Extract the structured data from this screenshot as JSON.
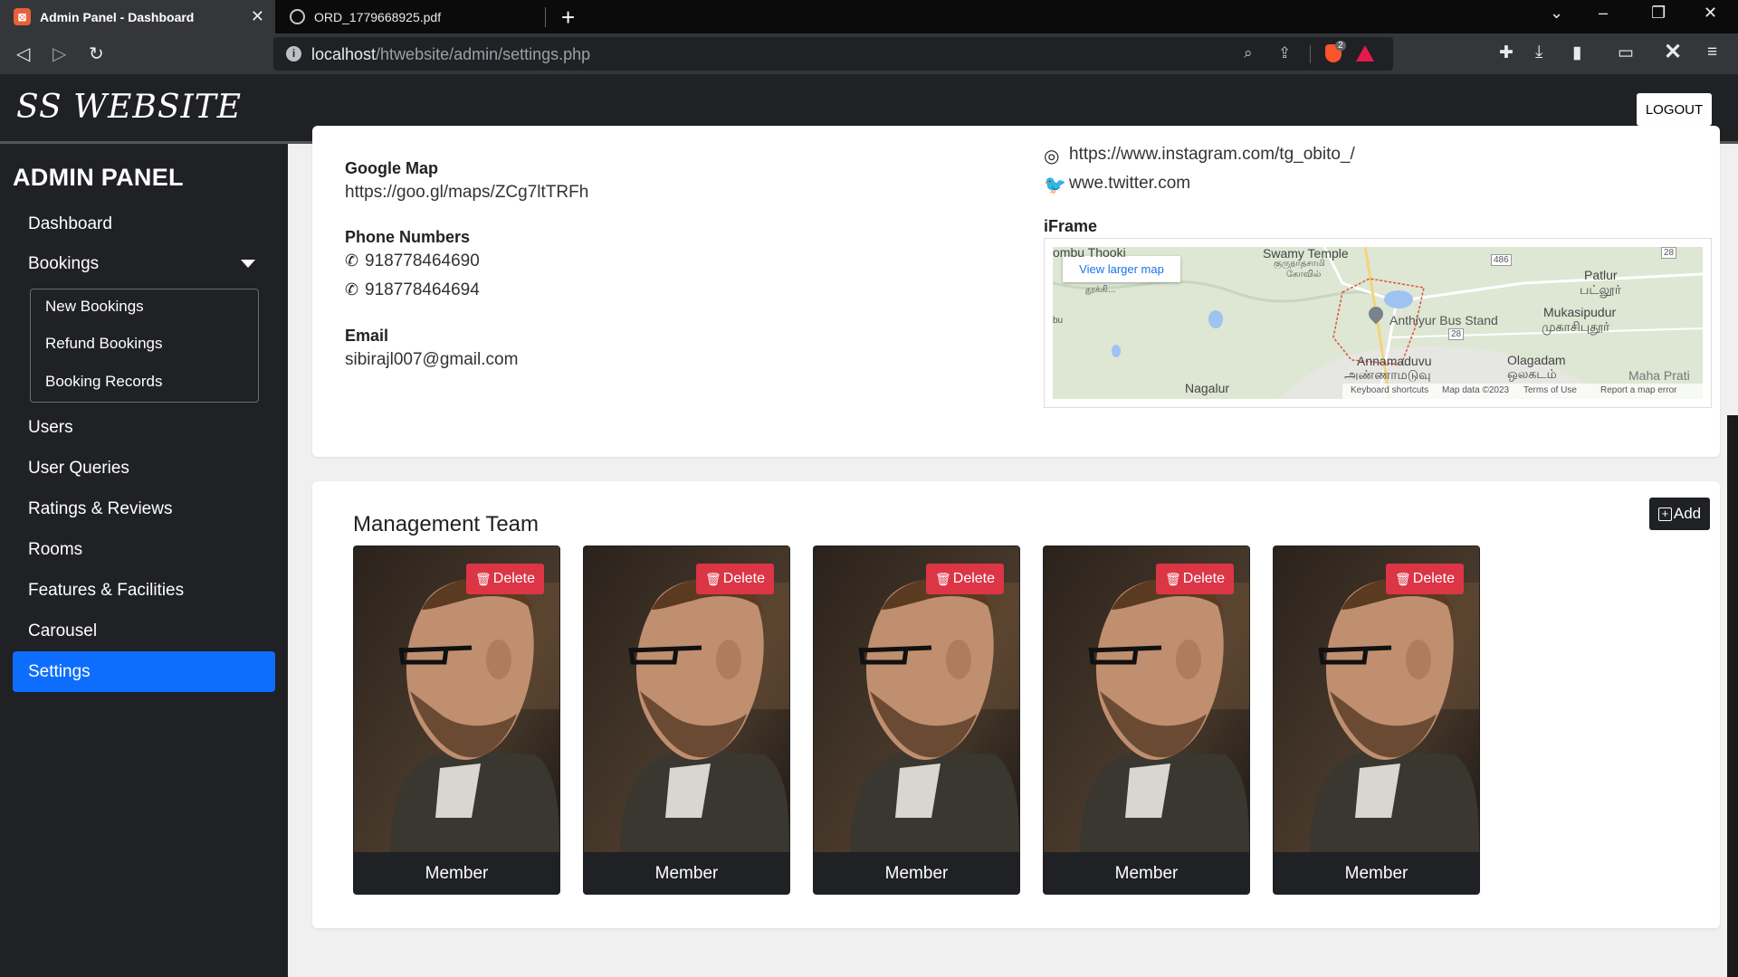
{
  "browser": {
    "tabs": [
      {
        "title": "Admin Panel - Dashboard",
        "active": true
      },
      {
        "title": "ORD_1779668925.pdf",
        "active": false
      }
    ],
    "url_host": "localhost",
    "url_path": "/htwebsite/admin/settings.php",
    "brave_badge": "2",
    "accent": "#0d6efd"
  },
  "topnav": {
    "brand": "SS WEBSITE",
    "logout_label": "LOGOUT"
  },
  "sidebar": {
    "title": "ADMIN PANEL",
    "items": [
      {
        "label": "Dashboard"
      },
      {
        "label": "Bookings"
      },
      {
        "label": "Users"
      },
      {
        "label": "User Queries"
      },
      {
        "label": "Ratings & Reviews"
      },
      {
        "label": "Rooms"
      },
      {
        "label": "Features & Facilities"
      },
      {
        "label": "Carousel"
      },
      {
        "label": "Settings",
        "active": true
      }
    ],
    "booking_subitems": [
      "New Bookings",
      "Refund Bookings",
      "Booking Records"
    ]
  },
  "contact": {
    "google_map_label": "Google Map",
    "google_map_value": "https://goo.gl/maps/ZCg7ltTRFh",
    "phone_label": "Phone Numbers",
    "phones": [
      "918778464690",
      "918778464694"
    ],
    "email_label": "Email",
    "email_value": "sibirajl007@gmail.com",
    "instagram": "https://www.instagram.com/tg_obito_/",
    "twitter": "wwe.twitter.com",
    "iframe_label": "iFrame"
  },
  "map": {
    "view_larger": "View larger map",
    "labels": {
      "thooki": "ombu Thooki",
      "swamy": "Swamy Temple",
      "swamy_ta": "குருநாதசாமி",
      "kovil": "கோவில்",
      "thuki_ta": "தூக்கி...",
      "bu": "bu",
      "patlur": "Patlur",
      "patlur_ta": "பட்லூர்",
      "mukasipudur": "Mukasipudur",
      "mukasipudur_ta": "முகாசிபுதூர்",
      "anthiyur": "Anthiyur Bus Stand",
      "annamaduvu": "Annamaduvu",
      "annamaduvu_ta": "அண்ணாமடுவு",
      "olagadam": "Olagadam",
      "olagadam_ta": "ஒலகடம்",
      "nagalur": "Nagalur",
      "maha": "Maha Prati",
      "r486": "486",
      "r28a": "28",
      "r28b": "28"
    },
    "footer": [
      "Keyboard shortcuts",
      "Map data ©2023",
      "Terms of Use",
      "Report a map error"
    ]
  },
  "team": {
    "title": "Management Team",
    "add_label": "Add",
    "delete_label": "Delete",
    "members": [
      {
        "name": "Member"
      },
      {
        "name": "Member"
      },
      {
        "name": "Member"
      },
      {
        "name": "Member"
      },
      {
        "name": "Member"
      }
    ]
  }
}
